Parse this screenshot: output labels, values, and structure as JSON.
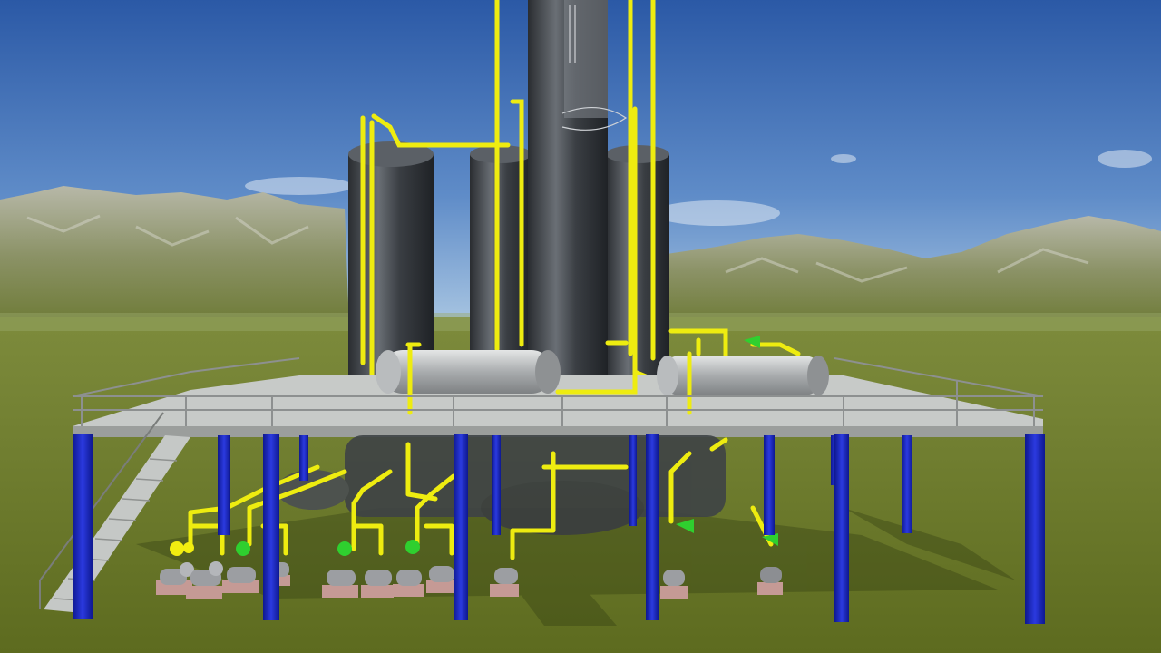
{
  "scene": {
    "description_visible_text": "",
    "colors": {
      "sky_top": "#2f5ea8",
      "sky_bottom": "#8fb4dc",
      "ground": "#6d7a2a",
      "ground_far": "#7f8a3a",
      "mountain": "#8a8f78",
      "vessel": "#3f4347",
      "platform": "#c9cbc9",
      "column_blue": "#1a26c8",
      "pipe_yellow": "#f2f016",
      "valve_green": "#2fd12f",
      "pump_grey": "#9a9ca0"
    },
    "icons": [
      "process-tower",
      "storage-vessel",
      "horizontal-drum",
      "pump",
      "valve",
      "stair"
    ]
  }
}
